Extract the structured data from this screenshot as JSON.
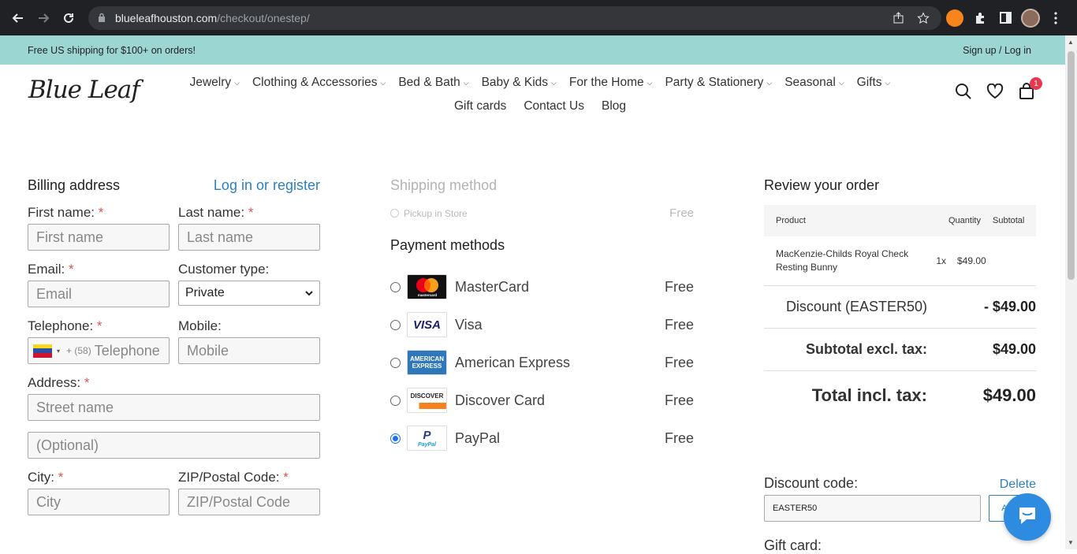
{
  "browser": {
    "url_host": "blueleafhouston.com",
    "url_path": "/checkout/onestep/"
  },
  "announcement": {
    "shipping_text": "Free US shipping for $100+ on orders!",
    "auth_link": "Sign up / Log in"
  },
  "header": {
    "logo_text": "Blue Leaf",
    "menu_row1": [
      "Jewelry",
      "Clothing & Accessories",
      "Bed & Bath",
      "Baby & Kids",
      "For the Home",
      "Party & Stationery",
      "Seasonal",
      "Gifts"
    ],
    "menu_row2": [
      "Gift cards",
      "Contact Us",
      "Blog"
    ],
    "cart_count": "1"
  },
  "billing": {
    "title": "Billing address",
    "login_link": "Log in or register",
    "first_name_label": "First name:",
    "first_name_placeholder": "First name",
    "last_name_label": "Last name:",
    "last_name_placeholder": "Last name",
    "email_label": "Email:",
    "email_placeholder": "Email",
    "customer_type_label": "Customer type:",
    "customer_type_value": "Private",
    "telephone_label": "Telephone:",
    "telephone_prefix": "+ (58)",
    "telephone_placeholder": "Telephone",
    "mobile_label": "Mobile:",
    "mobile_placeholder": "Mobile",
    "address_label": "Address:",
    "street_placeholder": "Street name",
    "optional_placeholder": "(Optional)",
    "city_label": "City:",
    "city_placeholder": "City",
    "zip_label": "ZIP/Postal Code:",
    "zip_placeholder": "ZIP/Postal Code",
    "required_mark": "*"
  },
  "shipping": {
    "title": "Shipping method",
    "option_label": "Pickup in Store",
    "option_price": "Free"
  },
  "payment": {
    "title": "Payment methods",
    "methods": [
      {
        "name": "MasterCard",
        "price": "Free",
        "logo": "mastercard-logo",
        "selected": false
      },
      {
        "name": "Visa",
        "price": "Free",
        "logo": "visa-logo",
        "selected": false
      },
      {
        "name": "American Express",
        "price": "Free",
        "logo": "amex-logo",
        "selected": false
      },
      {
        "name": "Discover Card",
        "price": "Free",
        "logo": "discover-logo",
        "selected": false
      },
      {
        "name": "PayPal",
        "price": "Free",
        "logo": "paypal-logo",
        "selected": true
      }
    ],
    "logo_text": {
      "mastercard": "mastercard",
      "visa": "VISA",
      "amex_1": "AMERICAN",
      "amex_2": "EXPRESS",
      "discover": "DISCOVER",
      "paypal_1": "PayPal",
      "paypal_2": "PayPal"
    }
  },
  "review": {
    "title": "Review your order",
    "col_product": "Product",
    "col_quantity": "Quantity",
    "col_subtotal": "Subtotal",
    "items": [
      {
        "name": "MacKenzie-Childs Royal Check Resting Bunny",
        "qty": "1x",
        "subtotal": "$49.00"
      }
    ],
    "discount_label": "Discount (EASTER50)",
    "discount_value": "- $49.00",
    "subtotal_label": "Subtotal excl. tax:",
    "subtotal_value": "$49.00",
    "total_label": "Total incl. tax:",
    "total_value": "$49.00",
    "discount_code_label": "Discount code:",
    "delete_link": "Delete",
    "discount_code_value": "EASTER50",
    "apply_button": "Apply",
    "gift_card_label": "Gift card:"
  },
  "colors": {
    "announce_bg": "#9bd6d3",
    "link_blue": "#2e7fc2",
    "required_red": "#d9534f",
    "chat_blue": "#2d8be0"
  }
}
